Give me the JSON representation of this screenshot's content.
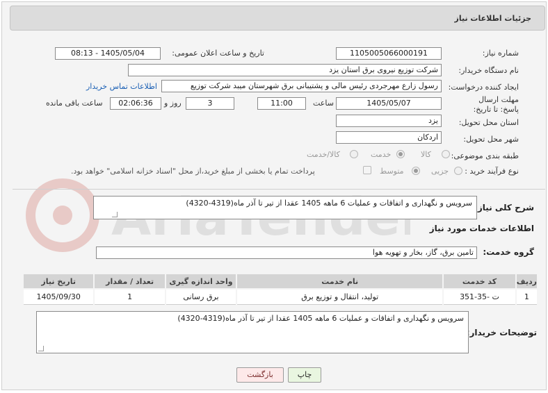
{
  "header": {
    "title": "جزئیات اطلاعات نیاز"
  },
  "form": {
    "need_number_label": "شماره نیاز:",
    "need_number": "1105005066000191",
    "announce_label": "تاریخ و ساعت اعلان عمومی:",
    "announce_value": "1405/05/04 - 08:13",
    "buyer_org_label": "نام دستگاه خریدار:",
    "buyer_org": "شرکت توزیع نیروی برق استان یزد",
    "creator_label": "ایجاد کننده درخواست:",
    "creator": "رسول  زارع مهرجردی  رئیس مالی و پشتیبانی برق شهرستان میبد شرکت توزیع",
    "buyer_contact_link": "اطلاعات تماس خریدار",
    "deadline_label": "مهلت ارسال پاسخ: تا تاریخ:",
    "deadline_date": "1405/05/07",
    "time_label": "ساعت",
    "deadline_time": "11:00",
    "days_value": "3",
    "days_label": "روز و",
    "remaining_time": "02:06:36",
    "remaining_label": "ساعت باقی مانده",
    "province_label": "استان محل تحویل:",
    "province": "یزد",
    "city_label": "شهر محل تحویل:",
    "city": "اردکان",
    "category_label": "طبقه بندی موضوعی:",
    "category_options": [
      "کالا",
      "خدمت",
      "کالا/خدمت"
    ],
    "category_selected": 1,
    "process_label": "نوع فرآیند خرید :",
    "process_options": [
      "جزیی",
      "متوسط"
    ],
    "process_selected": 1,
    "payment_note": "پرداخت تمام یا بخشی از مبلغ خرید،از محل \"اسناد خزانه اسلامی\" خواهد بود."
  },
  "summary": {
    "label": "شرح کلی نیاز:",
    "text": "سرویس و نگهداری و اتفاقات و عملیات 6 ماهه 1405 عقدا از تیر تا آذر ماه(4319-4320)"
  },
  "services": {
    "section_title": "اطلاعات خدمات مورد نیاز",
    "group_label": "گروه خدمت:",
    "group_value": "تامین برق، گاز، بخار و تهویه هوا",
    "columns": [
      "ردیف",
      "کد خدمت",
      "نام خدمت",
      "واحد اندازه گیری",
      "تعداد / مقدار",
      "تاریخ نیاز"
    ],
    "rows": [
      [
        "1",
        "ت -35-351",
        "تولید، انتقال و توزیع برق",
        "برق رسانی",
        "1",
        "1405/09/30"
      ]
    ]
  },
  "buyer_notes": {
    "label": "توضیحات خریدار:",
    "text": "سرویس و نگهداری و اتفاقات و عملیات 6 ماهه 1405 عقدا از تیر تا آذر ماه(4319-4320)"
  },
  "buttons": {
    "print": "چاپ",
    "back": "بازگشت"
  },
  "colors": {
    "back_button_bg": "#fde9e9",
    "print_button_bg": "#e9f6e0",
    "link": "#1a5fb4"
  }
}
